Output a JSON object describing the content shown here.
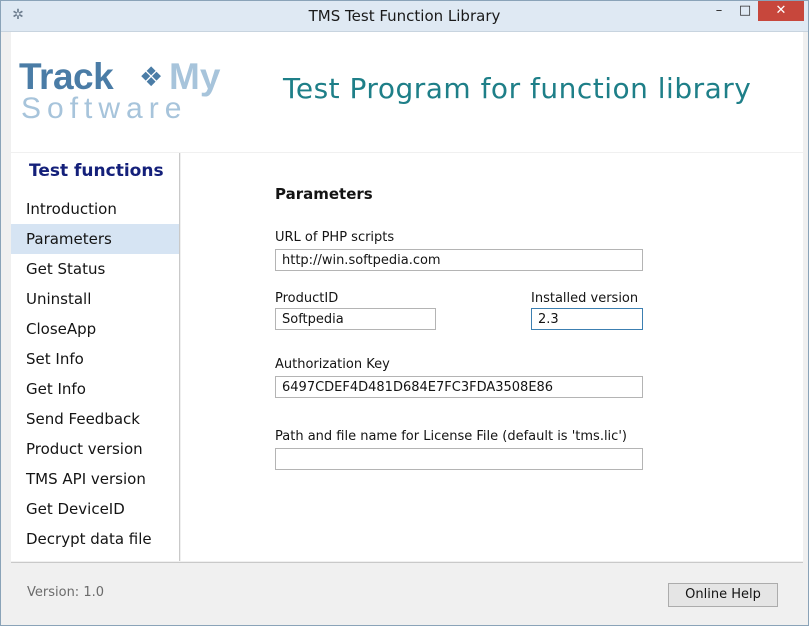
{
  "window": {
    "title": "TMS Test Function Library",
    "icon": "app-star-icon",
    "controls": {
      "minimize": "–",
      "maximize": "□",
      "close": "✕"
    }
  },
  "header": {
    "logo": {
      "track": "Track",
      "my": "My",
      "software": "Software",
      "star": "❖"
    },
    "heading": "Test Program for function library"
  },
  "sidebar": {
    "title": "Test functions",
    "items": [
      {
        "label": "Introduction"
      },
      {
        "label": "Parameters",
        "selected": true
      },
      {
        "label": "Get Status"
      },
      {
        "label": "Uninstall"
      },
      {
        "label": "CloseApp"
      },
      {
        "label": "Set Info"
      },
      {
        "label": "Get Info"
      },
      {
        "label": "Send Feedback"
      },
      {
        "label": "Product version"
      },
      {
        "label": "TMS API version"
      },
      {
        "label": "Get DeviceID"
      },
      {
        "label": "Decrypt data file"
      }
    ]
  },
  "main": {
    "section_title": "Parameters",
    "fields": {
      "url_label": "URL of PHP scripts",
      "url_value": "http://win.softpedia.com",
      "product_label": "ProductID",
      "product_value": "Softpedia",
      "installed_label": "Installed version",
      "installed_value": "2.3",
      "auth_label": "Authorization Key",
      "auth_value": "6497CDEF4D481D684E7FC3FDA3508E86",
      "license_label": "Path and file name for License File (default is 'tms.lic')",
      "license_value": ""
    }
  },
  "footer": {
    "version": "Version: 1.0",
    "help_button": "Online Help"
  },
  "colors": {
    "accent_heading": "#1e7f88",
    "sidebar_title": "#14207a",
    "selection": "#d6e4f3",
    "close_button": "#c7473c"
  }
}
